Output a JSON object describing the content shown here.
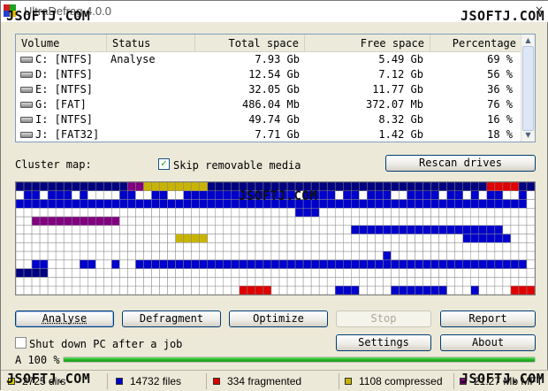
{
  "window": {
    "title": "UltraDefrag 4.0.0",
    "close_glyph": "×"
  },
  "watermarks": {
    "top_left": "JSOFTJ.COM",
    "top_right": "JSOFTJ.COM",
    "map_center": "JSOFTJ.COM",
    "bottom_left": "JSOFTJ.COM",
    "bottom_right": "JSOFTJ.COM"
  },
  "volumes": {
    "columns": [
      "Volume",
      "Status",
      "Total space",
      "Free space",
      "Percentage"
    ],
    "rows": [
      {
        "volume": "C: [NTFS]",
        "status": "Analyse",
        "total": "7.93 Gb",
        "free": "5.49 Gb",
        "pct": "69 %"
      },
      {
        "volume": "D: [NTFS]",
        "status": "",
        "total": "12.54 Gb",
        "free": "7.12 Gb",
        "pct": "56 %"
      },
      {
        "volume": "E: [NTFS]",
        "status": "",
        "total": "32.05 Gb",
        "free": "11.77 Gb",
        "pct": "36 %"
      },
      {
        "volume": "G: [FAT]",
        "status": "",
        "total": "486.04 Mb",
        "free": "372.07 Mb",
        "pct": "76 %"
      },
      {
        "volume": "I: [NTFS]",
        "status": "",
        "total": "49.74 Gb",
        "free": "8.32 Gb",
        "pct": "16 %"
      },
      {
        "volume": "J: [FAT32]",
        "status": "",
        "total": "7.71 Gb",
        "free": "1.42 Gb",
        "pct": "18 %"
      }
    ],
    "scroll_up": "▲",
    "scroll_down": "▼"
  },
  "cluster_map_label": "Cluster map:",
  "skip_removable": {
    "label": "Skip removable media",
    "checked": true,
    "check_glyph": "✓"
  },
  "rescan_label": "Rescan drives",
  "actions": {
    "analyse": "Analyse",
    "defragment": "Defragment",
    "optimize": "Optimize",
    "stop": "Stop",
    "report": "Report",
    "settings": "Settings",
    "about": "About"
  },
  "shutdown": {
    "label": "Shut down PC after a job",
    "checked": false
  },
  "progress": {
    "label": "A 100 %",
    "value": 100
  },
  "statusbar": {
    "dirs": "2725 dirs",
    "files": "14732 files",
    "fragmented": "334 fragmented",
    "compressed": "1108 compressed",
    "mft": "21.27 Mb MFT"
  },
  "colors": {
    "used": "#0000cc",
    "system": "#000080",
    "fragmented": "#e00000",
    "compressed": "#c8b400",
    "mft": "#800080",
    "free": "#ffffff",
    "dirs": "#e5d600",
    "grid": "#888888"
  },
  "cluster_map": {
    "cols": 65,
    "rows": 13,
    "legend": "u=used, n=system, r=fragmented, y=compressed, p=mft, .=free",
    "cells": [
      "nnnnnnnnnnnnnnppyyyyyyyynnnnnnnnnnnnnnnnnnnnnnnnnnnnnnnnnnnrrrrnnn",
      ".uu.uuu.u....uu..uu..uuuuuuuuuuuuuu.uuuu.uu.uuu..uuuu.uu.u.uu..u",
      "uuuuuuuuuuuuuuuuuuuuuuuuuuuuuuuuuuuuuuuuuuuuuuuuuuuuuuuuuuuuuuuu",
      "...................................uuu...........................",
      "..ppppppppppp....................................................",
      "..........................................uuuuuuuuuuuuuuuuuuu....",
      "....................yyyy................................uuuuuu...",
      ".................................................................",
      "..............................................u..................",
      "..uu....uu..u..uuuuuuuuuuuuuuuuuuuuuuuuuuuuuuuuuuuuuuuuuuuuuuuuu",
      "nnnn.............................................................",
      ".................................................................",
      "............................rrrr........uuu....uuuuuuu...u....rrrrrr"
    ]
  }
}
